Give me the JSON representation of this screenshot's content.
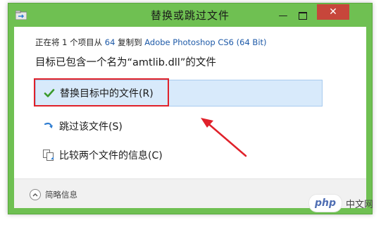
{
  "window": {
    "title": "替换或跳过文件",
    "minimize_glyph": "—",
    "close_glyph": "✕"
  },
  "copy_status": {
    "prefix": "正在将 1 个项目从 ",
    "source": "64",
    "middle": " 复制到 ",
    "destination": "Adobe Photoshop CS6 (64 Bit)"
  },
  "heading": "目标已包含一个名为“amtlib.dll”的文件",
  "options": [
    {
      "label": "替换目标中的文件(R)",
      "icon": "green-checkmark-icon",
      "selected": true
    },
    {
      "label": "跳过该文件(S)",
      "icon": "skip-arrow-icon",
      "selected": false
    },
    {
      "label": "比较两个文件的信息(C)",
      "icon": "compare-files-icon",
      "selected": false
    }
  ],
  "footer": {
    "toggle_label": "简略信息"
  },
  "watermark": {
    "badge": "php",
    "text": "中文网"
  },
  "colors": {
    "titlebar": "#6fc052",
    "close_button": "#c7463b",
    "selected_option_bg": "#d8eafb",
    "annotation_red": "#e0212a",
    "link_blue": "#1e5aa8"
  }
}
